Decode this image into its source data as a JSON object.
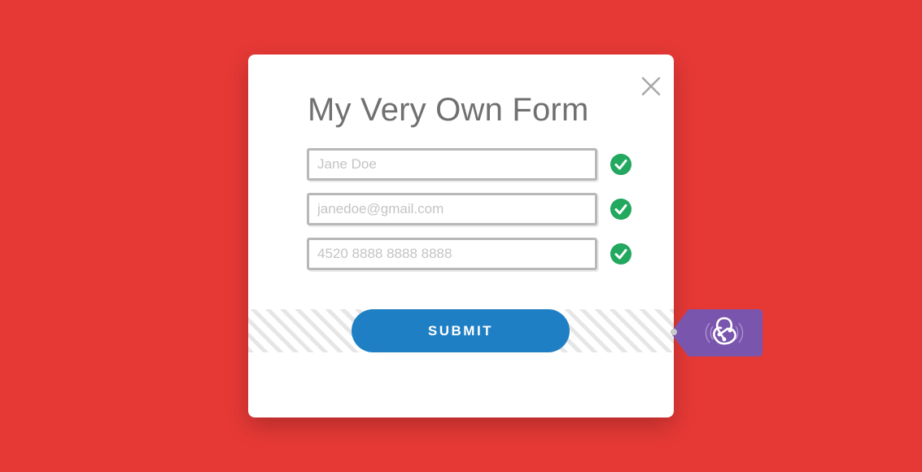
{
  "form": {
    "title": "My Very Own Form",
    "fields": [
      {
        "name": "name",
        "placeholder": "Jane Doe",
        "valid": true
      },
      {
        "name": "email",
        "placeholder": "janedoe@gmail.com",
        "valid": true
      },
      {
        "name": "card",
        "placeholder": "4520 8888 8888 8888",
        "valid": true
      }
    ],
    "submit_label": "SUBMIT"
  },
  "icons": {
    "close": "close-icon",
    "check": "checkmark-icon",
    "badge": "redux-logo-icon"
  },
  "colors": {
    "background": "#e63936",
    "card": "#ffffff",
    "primary": "#1e7fc4",
    "success": "#1fa25a",
    "badge": "#7a55ad"
  }
}
